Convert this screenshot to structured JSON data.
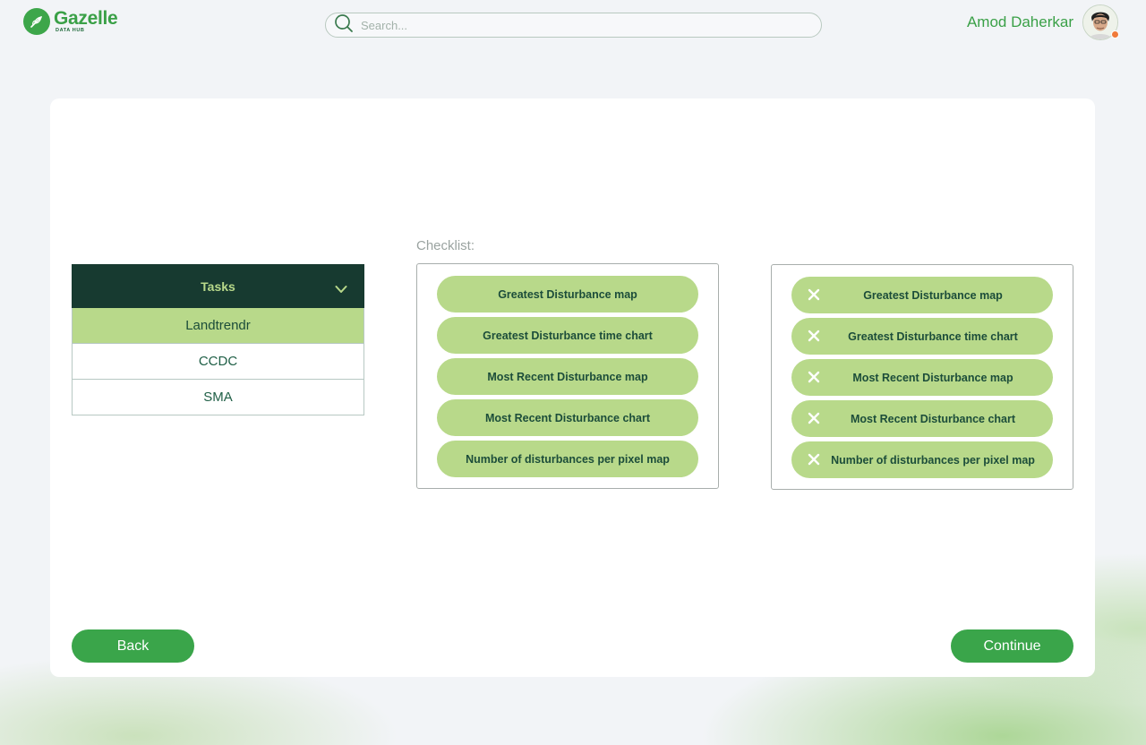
{
  "app": {
    "name": "Gazelle",
    "subtitle": "DATA HUB"
  },
  "search": {
    "placeholder": "Search..."
  },
  "user": {
    "name": "Amod Daherkar",
    "status_color": "#f07a3a"
  },
  "tasks": {
    "header": "Tasks",
    "items": [
      {
        "label": "Landtrendr",
        "active": true
      },
      {
        "label": "CCDC",
        "active": false
      },
      {
        "label": "SMA",
        "active": false
      }
    ]
  },
  "checklist": {
    "label": "Checklist:",
    "available": [
      "Greatest Disturbance map",
      "Greatest Disturbance time chart",
      "Most Recent Disturbance map",
      "Most Recent Disturbance chart",
      "Number of disturbances per pixel map"
    ],
    "selected": [
      "Greatest Disturbance map",
      "Greatest Disturbance time chart",
      "Most Recent Disturbance map",
      "Most Recent Disturbance chart",
      "Number of disturbances per pixel map"
    ]
  },
  "buttons": {
    "back": "Back",
    "continue": "Continue"
  },
  "colors": {
    "brand_green": "#3aa54a",
    "dark_green": "#173a30",
    "light_green": "#b8d98a"
  },
  "icons": {
    "logo": "gazelle-leaf-icon",
    "search": "search-icon",
    "chevron": "chevron-down-icon",
    "remove": "close-icon"
  }
}
